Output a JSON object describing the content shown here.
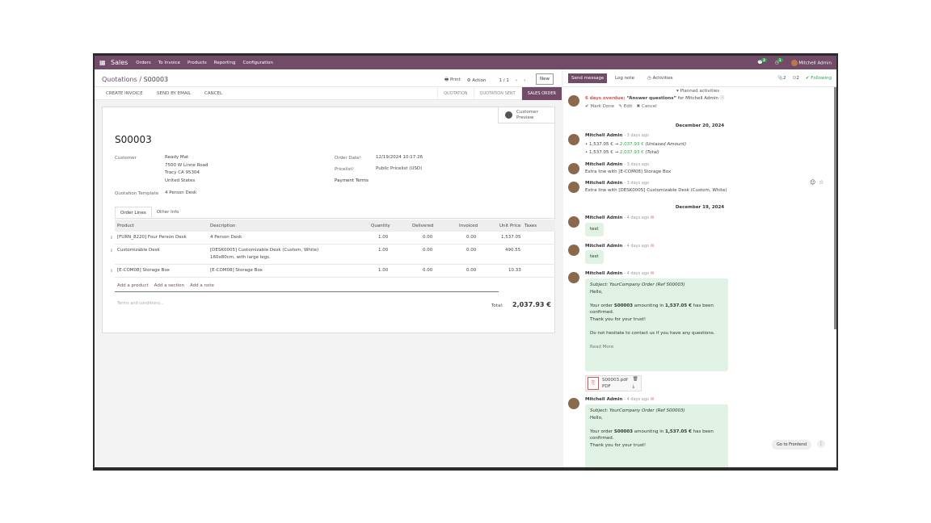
{
  "navbar": {
    "app_name": "Sales",
    "menus": [
      "Orders",
      "To Invoice",
      "Products",
      "Reporting",
      "Configuration"
    ],
    "messages_badge": "2",
    "activities_badge": "1",
    "user": "Mitchell Admin"
  },
  "control": {
    "breadcrumb_parent": "Quotations",
    "breadcrumb_sep": "/",
    "breadcrumb_current": "S00003",
    "print_label": "Print",
    "action_label": "Action",
    "pager": "1 / 1",
    "new_label": "New"
  },
  "actions": {
    "create_invoice": "CREATE INVOICE",
    "send_email": "SEND BY EMAIL",
    "cancel": "CANCEL",
    "statuses": [
      "QUOTATION",
      "QUOTATION SENT",
      "SALES ORDER"
    ]
  },
  "form": {
    "customer_preview": "Customer\nPreview",
    "order_no": "S00003",
    "customer_label": "Customer",
    "customer_lines": [
      "Ready Mat",
      "7500 W Linne Road",
      "Tracy CA 95304",
      "United States"
    ],
    "quotation_template_label": "Quotation Template",
    "quotation_template": "4 Person Desk",
    "order_date_label": "Order Date",
    "order_date": "12/19/2024 10:17:26",
    "pricelist_label": "Pricelist",
    "pricelist": "Public Pricelist (USD)",
    "payment_terms_label": "Payment Terms",
    "tabs": [
      "Order Lines",
      "Other Info"
    ],
    "columns": [
      "Product",
      "Description",
      "Quantity",
      "Delivered",
      "Invoiced",
      "Unit Price",
      "Taxes"
    ],
    "lines": [
      {
        "product": "[FURN_8220] Four Person Desk",
        "description": "4 Person Desk",
        "quantity": "1.00",
        "delivered": "0.00",
        "invoiced": "0.00",
        "unit_price": "1,537.05"
      },
      {
        "product": "Customizable Desk",
        "description": "[DESK0005] Customizable Desk (Custom, White) 160x80cm, with large legs.",
        "quantity": "1.00",
        "delivered": "0.00",
        "invoiced": "0.00",
        "unit_price": "490.55"
      },
      {
        "product": "[E-COM08] Storage Box",
        "description": "[E-COM08] Storage Box",
        "quantity": "1.00",
        "delivered": "0.00",
        "invoiced": "0.00",
        "unit_price": "10.33"
      }
    ],
    "add_product": "Add a product",
    "add_section": "Add a section",
    "add_note": "Add a note",
    "terms_placeholder": "Terms and conditions...",
    "total_label": "Total:",
    "total_value": "2,037.93 €"
  },
  "chatter": {
    "send_message": "Send message",
    "log_note": "Log note",
    "activities": "Activities",
    "attachments_count": "2",
    "followers_count": "2",
    "following": "Following",
    "planned": "Planned activities",
    "activity": {
      "overdue": "6 days overdue:",
      "title": "“Answer questions”",
      "for": "for Mitchell Admin",
      "mark_done": "Mark Done",
      "edit": "Edit",
      "cancel": "Cancel"
    },
    "date1": "December 20, 2024",
    "date2": "December 19, 2024",
    "msg1": {
      "author": "Mitchell Admin",
      "time": "- 3 days ago",
      "line1_old": "1,537.05 €",
      "line1_new": "2,037.93 €",
      "line1_field": "(Untaxed Amount)",
      "line2_old": "1,537.05 €",
      "line2_new": "2,037.93 €",
      "line2_field": "(Total)"
    },
    "msg2": {
      "author": "Mitchell Admin",
      "time": "- 3 days ago",
      "text": "Extra line with [E-COM08] Storage Box"
    },
    "msg3": {
      "author": "Mitchell Admin",
      "time": "- 3 days ago",
      "text": "Extra line with [DESK0005] Customizable Desk (Custom, White)"
    },
    "msg4": {
      "author": "Mitchell Admin",
      "time": "- 4 days ago",
      "text": "test"
    },
    "msg5": {
      "author": "Mitchell Admin",
      "time": "- 4 days ago",
      "text": "test"
    },
    "msg6": {
      "author": "Mitchell Admin",
      "time": "- 4 days ago",
      "subject": "Subject: YourCompany Order (Ref S00003)",
      "hello": "Hello,",
      "body_pre": "Your order ",
      "body_ref": "S00003",
      "body_mid": " amounting in ",
      "body_amt": "1,537.05 €",
      "body_post": " has been confirmed.",
      "thanks": "Thank you for your trust!",
      "contact": "Do not hesitate to contact us if you have any questions.",
      "read_more": "Read More"
    },
    "attachment": {
      "name": "S00003.pdf",
      "type": "PDF"
    },
    "msg7": {
      "author": "Mitchell Admin",
      "time": "- 4 days ago",
      "subject": "Subject: YourCompany Order (Ref S00003)",
      "hello": "Hello,",
      "body_pre": "Your order ",
      "body_ref": "S00003",
      "body_mid": " amounting in ",
      "body_amt": "1,537.05 €",
      "body_post": " has been confirmed.",
      "thanks": "Thank you for your trust!"
    },
    "go_frontend": "Go to Frontend"
  }
}
